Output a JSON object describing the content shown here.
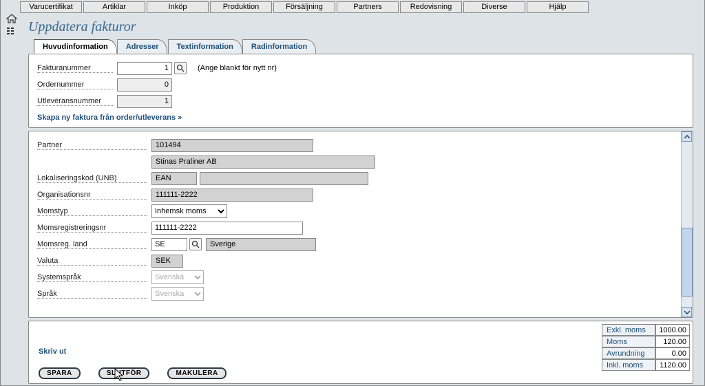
{
  "menu": [
    "Varucertifikat",
    "Artiklar",
    "Inköp",
    "Produktion",
    "Försäljning",
    "Partners",
    "Redovisning",
    "Diverse",
    "Hjälp"
  ],
  "page_title": "Uppdatera fakturor",
  "tabs": [
    {
      "label": "Huvudinformation",
      "active": true
    },
    {
      "label": "Adresser",
      "active": false
    },
    {
      "label": "Textinformation",
      "active": false
    },
    {
      "label": "Radinformation",
      "active": false
    }
  ],
  "top": {
    "fakturanummer_label": "Fakturanummer",
    "fakturanummer_value": "1",
    "fakturanummer_hint": "(Ange blankt för nytt nr)",
    "ordernummer_label": "Ordernummer",
    "ordernummer_value": "0",
    "utleverans_label": "Utleveransnummer",
    "utleverans_value": "1",
    "new_link": "Skapa ny faktura från order/utleverans »"
  },
  "mid": {
    "partner_label": "Partner",
    "partner_id": "101494",
    "partner_name": "Stinas Praliner AB",
    "unb_label": "Lokaliseringskod (UNB)",
    "unb_code": "EAN",
    "orgnr_label": "Organisationsnr",
    "orgnr_value": "111111-2222",
    "momstyp_label": "Momstyp",
    "momstyp_value": "Inhemsk moms",
    "momsregnr_label": "Momsregistreringsnr",
    "momsregnr_value": "111111-2222",
    "momsland_label": "Momsreg. land",
    "momsland_code": "SE",
    "momsland_name": "Sverige",
    "valuta_label": "Valuta",
    "valuta_value": "SEK",
    "syssprak_label": "Systemspråk",
    "syssprak_value": "Svenska",
    "sprak_label": "Språk",
    "sprak_value": "Svenska"
  },
  "bottom": {
    "print": "Skriv ut",
    "spara": "SPARA",
    "slutfor": "SLUTFÖR",
    "makulera": "MAKULERA"
  },
  "totals": {
    "exkl_label": "Exkl. moms",
    "exkl_value": "1000.00",
    "moms_label": "Moms",
    "moms_value": "120.00",
    "avr_label": "Avrundning",
    "avr_value": "0.00",
    "inkl_label": "Inkl. moms",
    "inkl_value": "1120.00"
  }
}
